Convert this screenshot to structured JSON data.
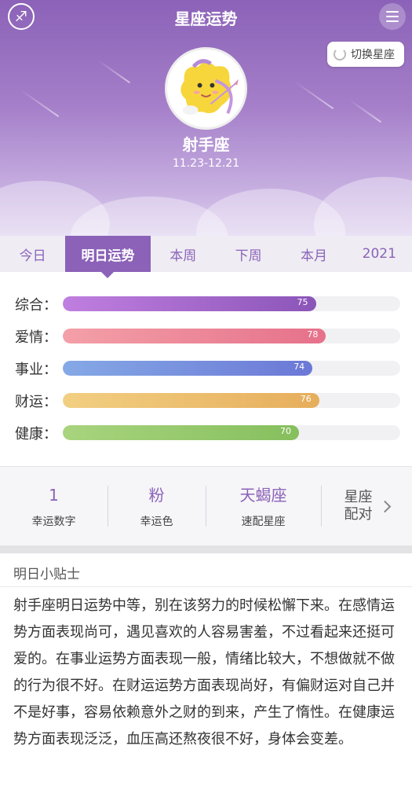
{
  "header": {
    "title": "星座运势",
    "switch_label": "切换星座",
    "sign_name": "射手座",
    "sign_dates": "11.23-12.21"
  },
  "icons": {
    "logo": "zodiac-logo-icon",
    "menu": "menu-icon",
    "switch": "refresh-icon",
    "avatar": "sagittarius-cupid-icon",
    "chevron": "chevron-right-icon"
  },
  "tabs": [
    {
      "label": "今日",
      "active": false
    },
    {
      "label": "明日运势",
      "active": true
    },
    {
      "label": "本周",
      "active": false
    },
    {
      "label": "下周",
      "active": false
    },
    {
      "label": "本月",
      "active": false
    },
    {
      "label": "2021",
      "active": false
    }
  ],
  "scores": [
    {
      "label": "综合：",
      "value": 75,
      "value_text": "75",
      "color_from": "#c07fe0",
      "color_to": "#8b55b8"
    },
    {
      "label": "爱情：",
      "value": 78,
      "value_text": "78",
      "color_from": "#f4a0a8",
      "color_to": "#e5718a"
    },
    {
      "label": "事业：",
      "value": 74,
      "value_text": "74",
      "color_from": "#85a9e6",
      "color_to": "#6b78d6"
    },
    {
      "label": "财运：",
      "value": 76,
      "value_text": "76",
      "color_from": "#f2cf82",
      "color_to": "#e6ae5c"
    },
    {
      "label": "健康：",
      "value": 70,
      "value_text": "70",
      "color_from": "#a8d47e",
      "color_to": "#86bf5e"
    }
  ],
  "lucky": {
    "number": {
      "value": "1",
      "label": "幸运数字"
    },
    "color": {
      "value": "粉",
      "label": "幸运色"
    },
    "sign": {
      "value": "天蝎座",
      "label": "速配星座"
    },
    "match": {
      "label": "星座配对"
    }
  },
  "tips": {
    "title": "明日小贴士",
    "text": "射手座明日运势中等，别在该努力的时候松懈下来。在感情运势方面表现尚可，遇见喜欢的人容易害羞，不过看起来还挺可爱的。在事业运势方面表现一般，情绪比较大，不想做就不做的行为很不好。在财运运势方面表现尚好，有偏财运对自己并不是好事，容易依赖意外之财的到来，产生了惰性。在健康运势方面表现泛泛，血压高还熬夜很不好，身体会变差。"
  },
  "colors": {
    "accent": "#8b62b8"
  }
}
